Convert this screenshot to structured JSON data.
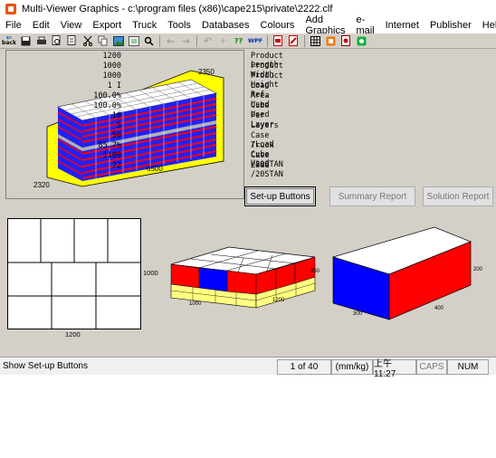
{
  "window": {
    "title": "Multi-Viewer Graphics - c:\\program files (x86)\\cape215\\private\\2222.clf"
  },
  "menu": [
    "File",
    "Edit",
    "View",
    "Export",
    "Truck",
    "Tools",
    "Databases",
    "Colours",
    "Add Graphics",
    "e-mail",
    "Internet",
    "Publisher",
    "Help"
  ],
  "toolbar": {
    "back_label": "back",
    "wpf_label": "WPF",
    "help_label": "??"
  },
  "truck_view": {
    "dim_height": "2350",
    "dim_length": "6500",
    "dim_width": "2320"
  },
  "stats": [
    {
      "label": "Product Length",
      "value": "1200"
    },
    {
      "label": "Product Width",
      "value": "1000"
    },
    {
      "label": "Product Height",
      "value": "1000"
    },
    {
      "label": "Load Ref.",
      "value": "1 I"
    },
    {
      "label": "Area Used",
      "value": "100.0%"
    },
    {
      "label": "Cube Used",
      "value": "100.0%"
    },
    {
      "label": "Per Layer",
      "value": "10"
    },
    {
      "label": "Layers",
      "value": "5"
    },
    {
      "label": "Case /Load",
      "value": "50"
    },
    {
      "label": "Truck Cube Used",
      "value": "85.7%"
    },
    {
      "label": "Case /20STAN",
      "value": "1100"
    },
    {
      "label": "Load /20STAN",
      "value": "22"
    }
  ],
  "buttons": {
    "setup": "Set-up Buttons",
    "summary": "Summary Report",
    "solution": "Solution Report"
  },
  "plan_view": {
    "dim_side": "1000",
    "dim_bottom": "1200"
  },
  "pallet_view": {
    "dim_height": "350",
    "dim_width": "1000",
    "dim_length": "1200"
  },
  "case_view": {
    "dim_height": "200",
    "dim_width": "300",
    "dim_length": "400"
  },
  "status": {
    "message": "Show Set-up Buttons",
    "page": "1 of 40",
    "units": "(mm/kg)",
    "time": "上午 11:27",
    "caps": "CAPS",
    "num": "NUM"
  },
  "colors": {
    "case_red": "#ff0000",
    "case_blue": "#0000ff",
    "truck_yellow": "#ffff00",
    "pallet_yellow": "#ffff80"
  }
}
